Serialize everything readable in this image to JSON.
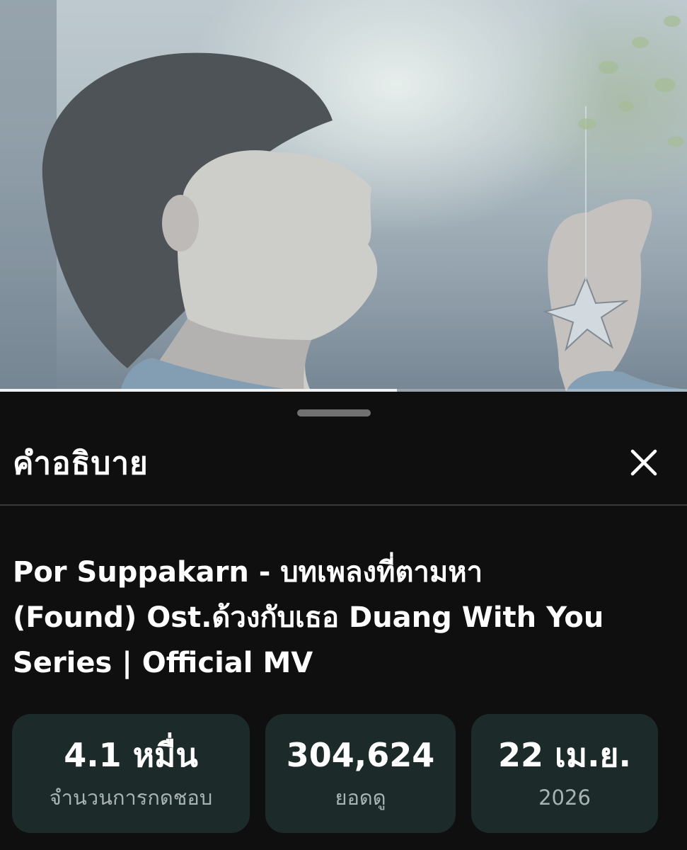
{
  "video": {
    "thumbnail_description_icon": "video-frame",
    "progress_fraction": 0.578
  },
  "sheet": {
    "title": "คำอธิบาย",
    "close_icon": "close-icon"
  },
  "video_title": "Por Suppakarn - บทเพลงที่ตามหา\n(Found) Ost.ด้วงกับเธอ Duang With You\nSeries | Official MV",
  "stats": [
    {
      "value": "4.1 หมื่น",
      "label": "จำนวนการกดชอบ"
    },
    {
      "value": "304,624",
      "label": "ยอดดู"
    },
    {
      "value": "22 เม.ย.",
      "label": "2026"
    }
  ],
  "colors": {
    "background": "#0f0f0f",
    "stat_card": "#1c2a2a",
    "label": "#a8b3b3",
    "progress": "#f1f1f1"
  }
}
